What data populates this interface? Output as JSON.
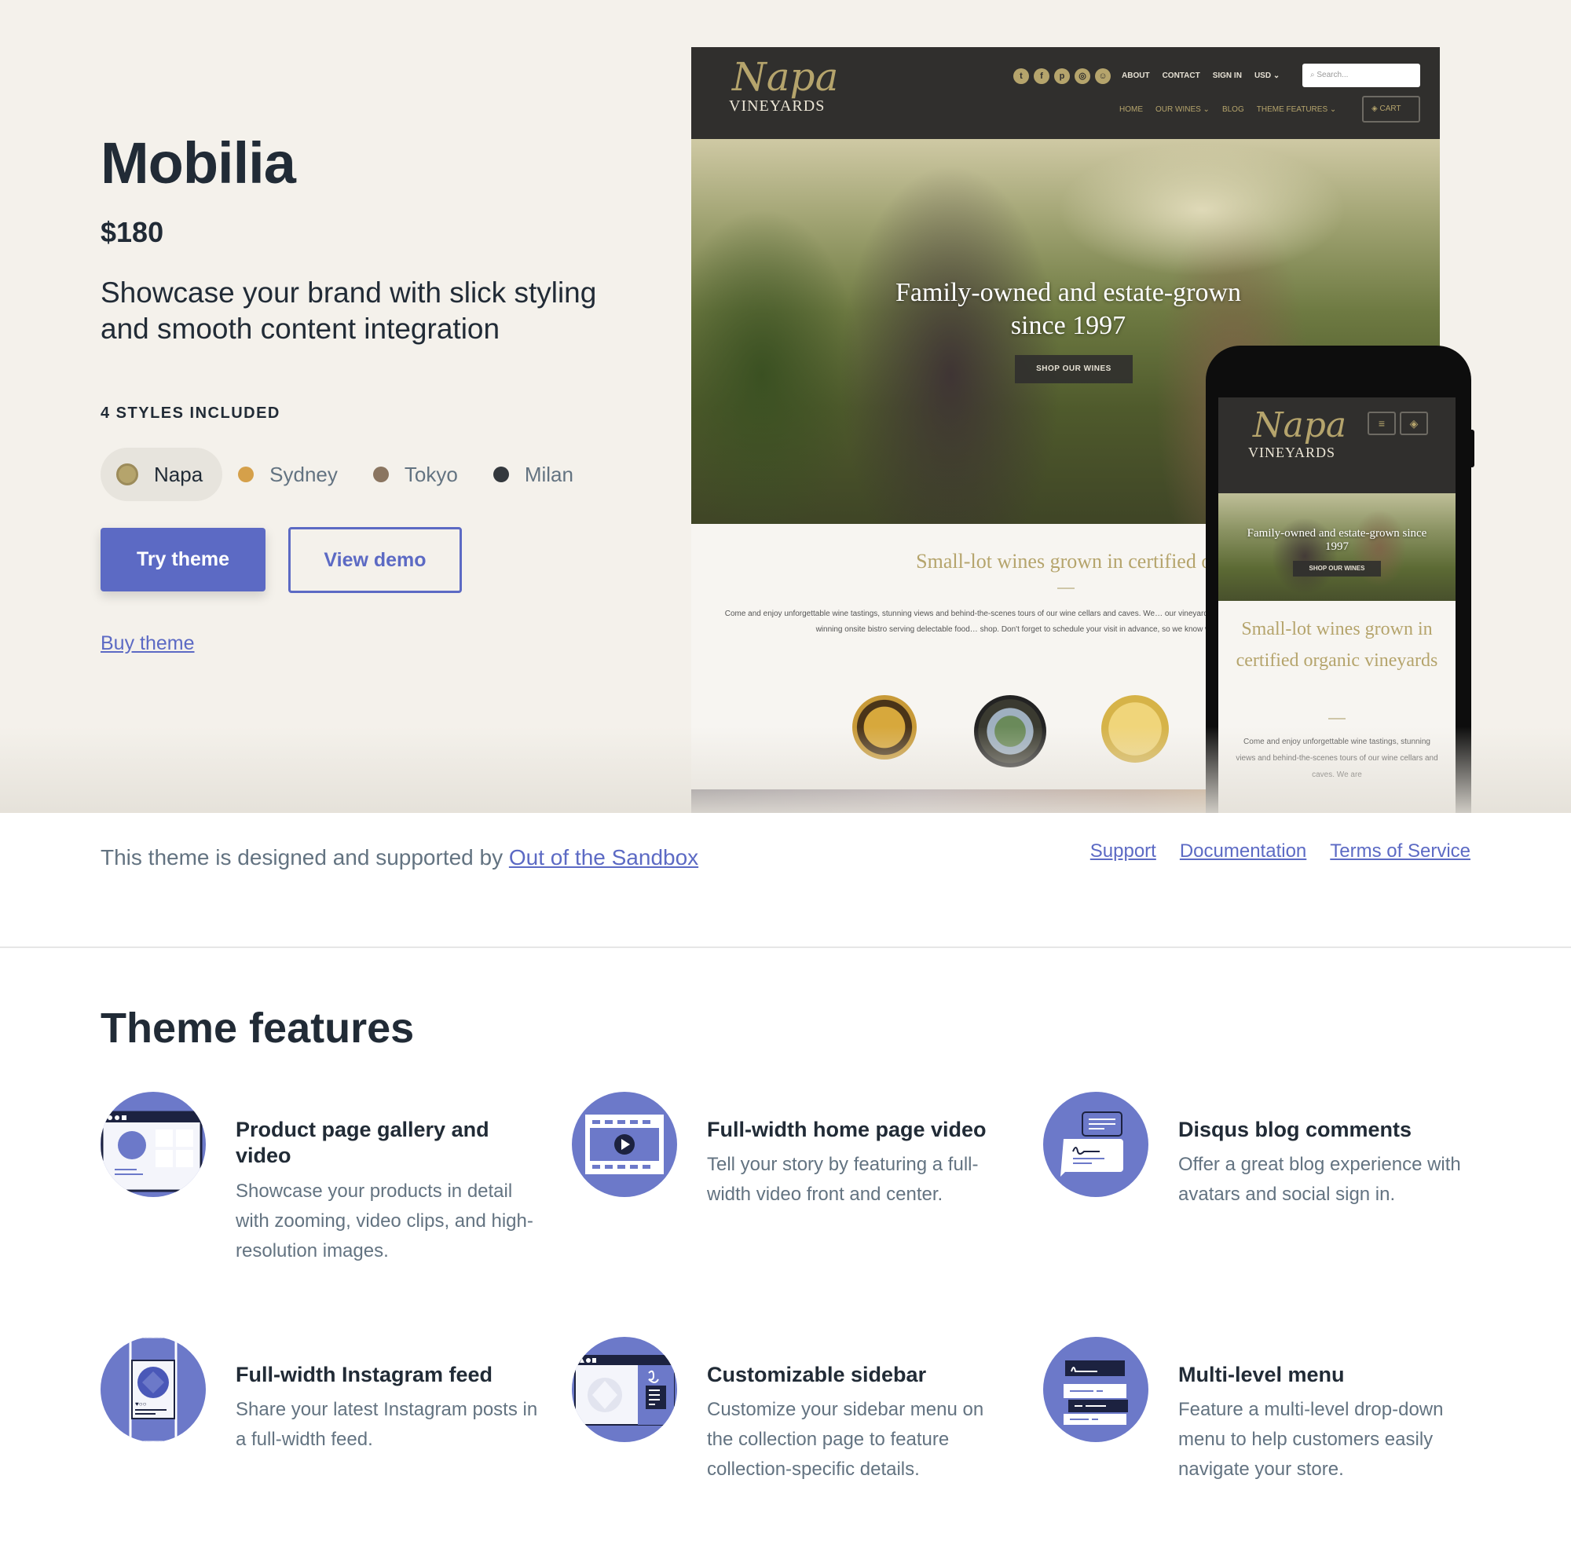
{
  "theme": {
    "name": "Mobilia",
    "price": "$180",
    "tagline": "Showcase your brand with slick styling and smooth content integration",
    "styles_label": "4 STYLES INCLUDED",
    "styles": [
      {
        "name": "Napa",
        "color": "#b5a46c",
        "selected": true
      },
      {
        "name": "Sydney",
        "color": "#d5a04a",
        "selected": false
      },
      {
        "name": "Tokyo",
        "color": "#8a7560",
        "selected": false
      },
      {
        "name": "Milan",
        "color": "#33383d",
        "selected": false
      }
    ],
    "try_label": "Try theme",
    "demo_label": "View demo",
    "buy_label": "Buy theme",
    "accent_color": "#5c6ac4"
  },
  "preview": {
    "desktop": {
      "logo_script": "Napa",
      "logo_caps": "VINEYARDS",
      "social_icons": [
        "twitter-icon",
        "facebook-icon",
        "pinterest-icon",
        "instagram-icon",
        "snapchat-icon"
      ],
      "top_links": [
        "ABOUT",
        "CONTACT",
        "SIGN IN",
        "USD ⌄"
      ],
      "search_placeholder": "Search...",
      "main_links": [
        "HOME",
        "OUR WINES ⌄",
        "BLOG",
        "THEME FEATURES ⌄"
      ],
      "cart_label": "CART",
      "hero_text": "Family-owned and estate-grown since 1997",
      "shop_label": "SHOP OUR WINES",
      "heading": "Small-lot wines grown in certified organic",
      "paragraph": "Come and enjoy unforgettable wine tastings, stunning views and behind-the-scenes tours of our wine cellars and caves. We… our vineyards will feel like home. We also have sit-down tastings, an award-winning onsite bistro serving delectable food… shop. Don't forget to schedule your visit in advance, so we know when to expect you and have every…"
    },
    "mobile": {
      "logo_script": "Napa",
      "logo_caps": "VINEYARDS",
      "menu_icon": "≡",
      "cart_icon": "🧺",
      "hero_text": "Family-owned and estate-grown since 1997",
      "shop_label": "SHOP OUR WINES",
      "heading": "Small-lot wines grown in certified organic vineyards",
      "paragraph": "Come and enjoy unforgettable wine tastings, stunning views and behind-the-scenes tours of our wine cellars and caves. We are"
    }
  },
  "attribution": {
    "text": "This theme is designed and supported by ",
    "link": "Out of the Sandbox"
  },
  "footer_links": [
    "Support",
    "Documentation",
    "Terms of Service"
  ],
  "features": {
    "title": "Theme features",
    "items": [
      {
        "icon": "product-gallery-icon",
        "title": "Product page gallery and video",
        "description": "Showcase your products in detail with zooming, video clips, and high-resolution images."
      },
      {
        "icon": "video-film-icon",
        "title": "Full-width home page video",
        "description": "Tell your story by featuring a full-width video front and center."
      },
      {
        "icon": "blog-comments-icon",
        "title": "Disqus blog comments",
        "description": "Offer a great blog experience with avatars and social sign in."
      },
      {
        "icon": "instagram-feed-icon",
        "title": "Full-width Instagram feed",
        "description": "Share your latest Instagram posts in a full-width feed."
      },
      {
        "icon": "sidebar-icon",
        "title": "Customizable sidebar",
        "description": "Customize your sidebar menu on the collection page to feature collection-specific details."
      },
      {
        "icon": "multi-level-menu-icon",
        "title": "Multi-level menu",
        "description": "Feature a multi-level drop-down menu to help customers easily navigate your store."
      }
    ]
  }
}
